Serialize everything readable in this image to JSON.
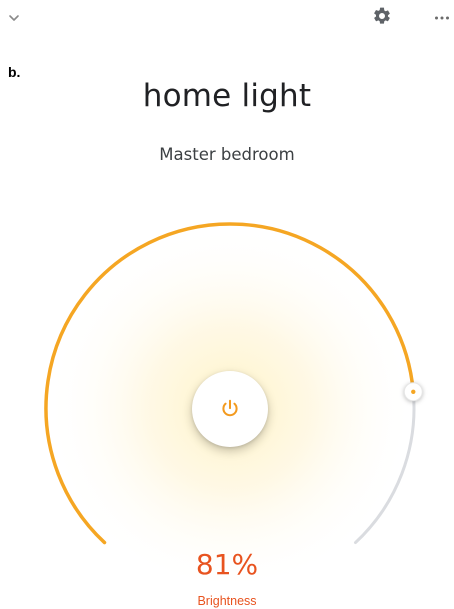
{
  "header": {
    "back_icon": "chevron-down-icon",
    "settings_icon": "gear-icon",
    "more_icon": "more-horizontal-icon"
  },
  "panel_label": "b.",
  "device": {
    "name": "home light",
    "room": "Master bedroom"
  },
  "brightness": {
    "percent": 81,
    "value_text": "81%",
    "label": "Brightness"
  },
  "power": {
    "icon": "power-icon",
    "state": "on"
  },
  "colors": {
    "accent": "#f5a623",
    "arc_inactive": "#dadce0",
    "text_accent": "#e8531f",
    "glow": "#fff3d6"
  }
}
